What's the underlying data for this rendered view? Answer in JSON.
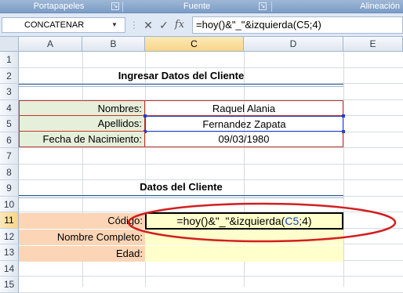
{
  "ribbon": {
    "groups": [
      {
        "label": "Portapapeles"
      },
      {
        "label": "Fuente"
      },
      {
        "label": "Alineación"
      }
    ]
  },
  "formula_bar": {
    "name_box": "CONCATENAR",
    "cancel_glyph": "✕",
    "enter_glyph": "✓",
    "fx_glyph": "fx",
    "formula": "=hoy()&\"_\"&izquierda(C5;4)"
  },
  "columns": [
    "A",
    "B",
    "C",
    "D",
    "E"
  ],
  "rows": [
    "1",
    "2",
    "3",
    "4",
    "5",
    "6",
    "7",
    "8",
    "9",
    "10",
    "11",
    "12",
    "13",
    "14",
    "15"
  ],
  "section1": {
    "title": "Ingresar Datos del Cliente",
    "fields": [
      {
        "label": "Nombres:",
        "value": "Raquel Alania"
      },
      {
        "label": "Apellidos:",
        "value": "Fernandez Zapata"
      },
      {
        "label": "Fecha de Nacimiento:",
        "value": "09/03/1980"
      }
    ]
  },
  "section2": {
    "title": "Datos del Cliente",
    "fields": [
      {
        "label": "Código:",
        "value": "=hoy()&\"_\"&izquierda(",
        "ref": "C5",
        "tail": ";4)"
      },
      {
        "label": "Nombre Completo:",
        "value": ""
      },
      {
        "label": "Edad:",
        "value": ""
      }
    ]
  },
  "colors": {
    "label_green": "#e6efda",
    "label_orange": "#fbd5b5",
    "value_yellow": "#ffffcc",
    "ref_blue": "#1f3fd0",
    "input_border_red": "#c0392b",
    "annotation_red": "#d21f1f"
  }
}
